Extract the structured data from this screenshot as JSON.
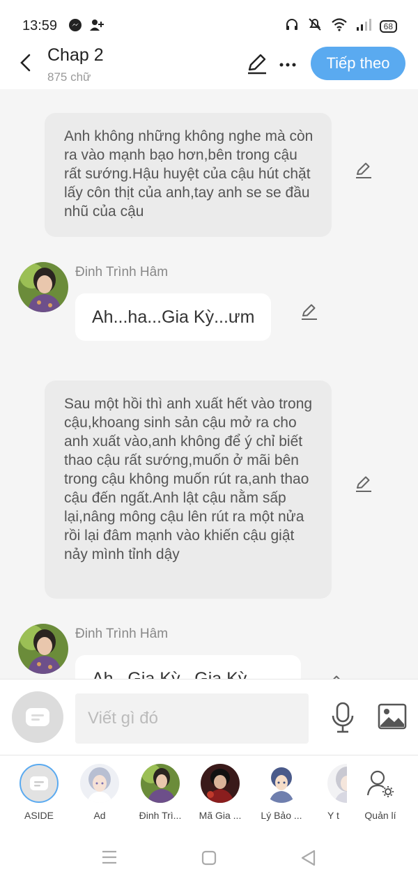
{
  "status_bar": {
    "time": "13:59",
    "left_icons": [
      "messenger-icon",
      "add-contact-icon"
    ],
    "right_icons": [
      "headphones-icon",
      "mute-icon",
      "wifi-icon",
      "signal-icon"
    ],
    "battery": "68"
  },
  "header": {
    "title": "Chap 2",
    "word_count": "875 chữ",
    "next_button": "Tiếp theo"
  },
  "messages": [
    {
      "type": "narration",
      "text": "Anh không những không nghe mà còn ra vào mạnh bạo hơn,bên trong cậu rất sướng.Hậu huyệt của cậu hút chặt lấy côn thịt của anh,tay anh se se đầu nhũ của cậu"
    },
    {
      "type": "dialogue",
      "speaker": "Đinh Trình Hâm",
      "text": "Ah...ha...Gia Kỳ...ưm"
    },
    {
      "type": "narration",
      "text": "Sau một hồi thì anh xuất hết vào trong cậu,khoang sinh sản cậu mở ra cho anh xuất vào,anh không để ý chỉ biết thao cậu rất sướng,muốn ở mãi bên trong cậu không muốn rút ra,anh thao cậu đến ngất.Anh lật cậu nằm sấp lại,nâng mông cậu lên rút ra một nửa rồi lại đâm mạnh vào khiến cậu giật nảy mình tỉnh dậy"
    },
    {
      "type": "dialogue",
      "speaker": "Đinh Trình Hâm",
      "text": "Ah...Gia Kỳ...Gia Kỳ..."
    }
  ],
  "composer": {
    "placeholder": "Viết gì đó"
  },
  "characters": [
    {
      "label": "ASIDE"
    },
    {
      "label": "Ad"
    },
    {
      "label": "Đinh Trì..."
    },
    {
      "label": "Mã Gia ..."
    },
    {
      "label": "Lý Bảo ..."
    },
    {
      "label": "Y t"
    },
    {
      "label": "Quản lí"
    }
  ],
  "colors": {
    "accent": "#5aaaf0",
    "narration_bg": "#ebebeb",
    "chat_bg": "#f5f5f5"
  }
}
